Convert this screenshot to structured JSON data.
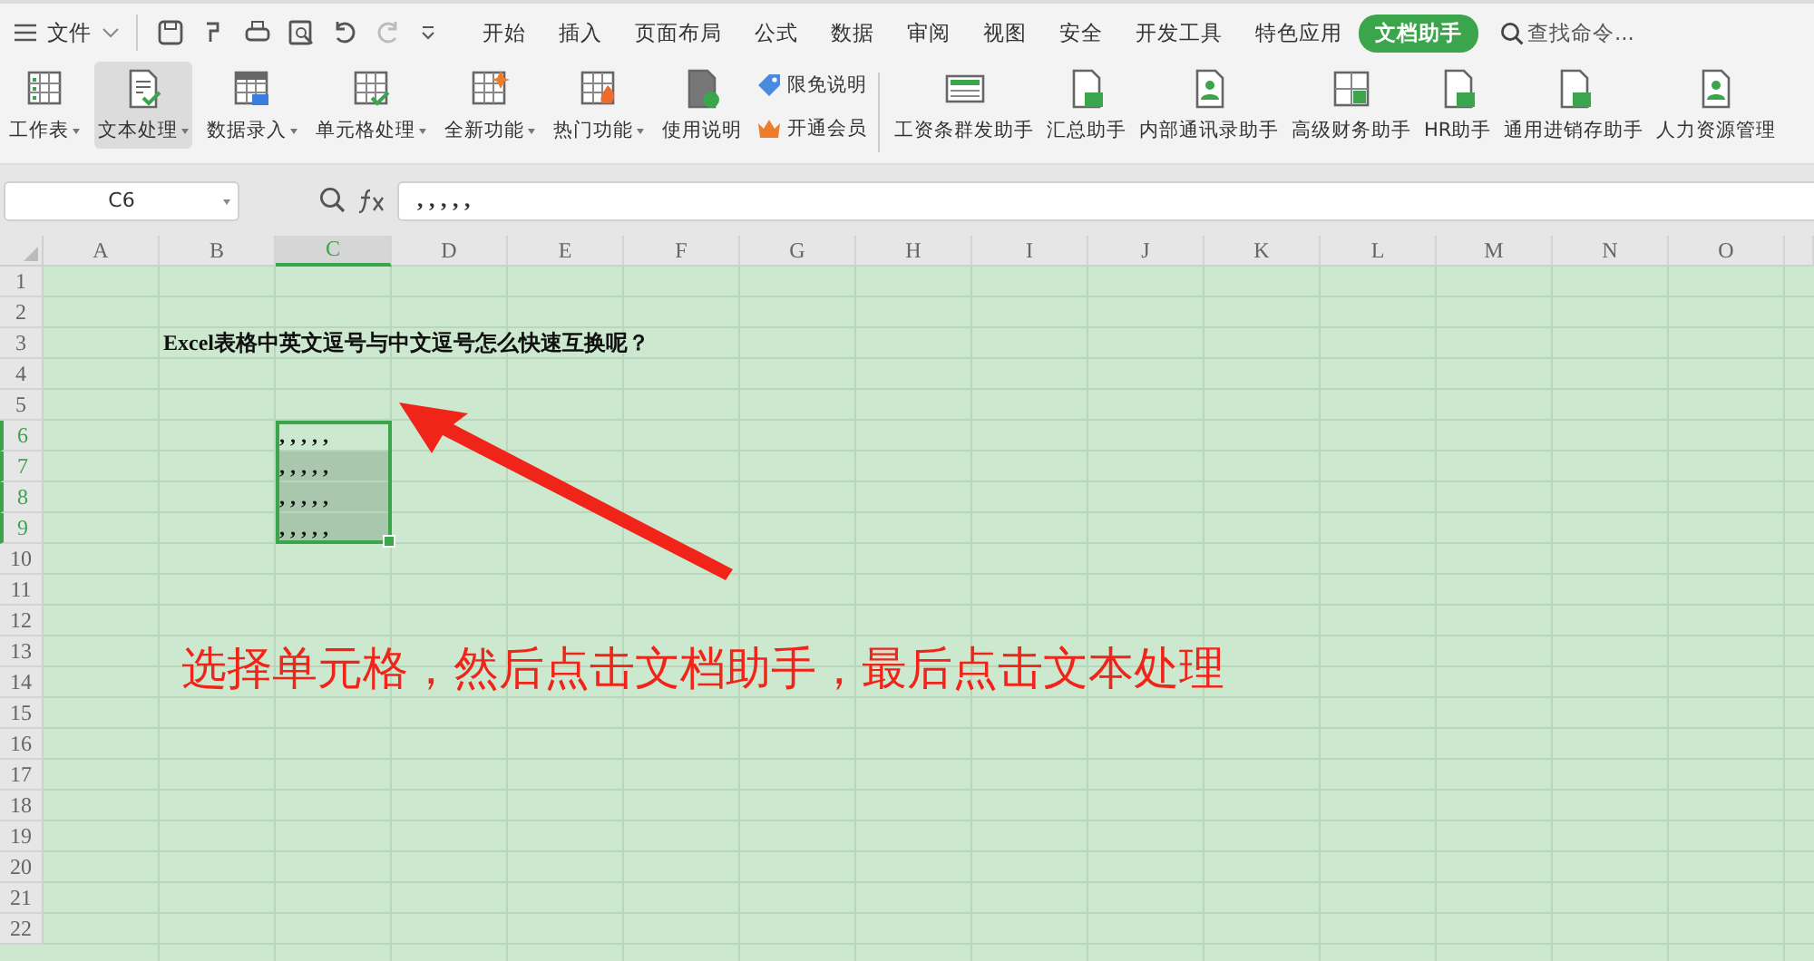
{
  "menubar": {
    "file_label": "文件",
    "tabs": [
      {
        "label": "开始",
        "selected": false
      },
      {
        "label": "插入",
        "selected": false
      },
      {
        "label": "页面布局",
        "selected": false
      },
      {
        "label": "公式",
        "selected": false
      },
      {
        "label": "数据",
        "selected": false
      },
      {
        "label": "审阅",
        "selected": false
      },
      {
        "label": "视图",
        "selected": false
      },
      {
        "label": "安全",
        "selected": false
      },
      {
        "label": "开发工具",
        "selected": false
      },
      {
        "label": "特色应用",
        "selected": false
      },
      {
        "label": "文档助手",
        "selected": true
      }
    ],
    "search_placeholder": "查找命令..."
  },
  "ribbon": {
    "tools": [
      {
        "label": "工作表",
        "dropdown": true,
        "selected": false
      },
      {
        "label": "文本处理",
        "dropdown": true,
        "selected": true
      },
      {
        "label": "数据录入",
        "dropdown": true,
        "selected": false
      },
      {
        "label": "单元格处理",
        "dropdown": true,
        "selected": false
      },
      {
        "label": "全新功能",
        "dropdown": true,
        "selected": false
      },
      {
        "label": "热门功能",
        "dropdown": true,
        "selected": false
      },
      {
        "label": "使用说明",
        "dropdown": false,
        "selected": false
      }
    ],
    "links": [
      "限免说明",
      "开通会员"
    ],
    "helpers": [
      "工资条群发助手",
      "汇总助手",
      "内部通讯录助手",
      "高级财务助手",
      "HR助手",
      "通用进销存助手",
      "人力资源管理"
    ]
  },
  "formula_bar": {
    "name_box": "C6",
    "formula": ", , , , ,"
  },
  "sheet": {
    "columns": [
      {
        "label": "A",
        "selected": false
      },
      {
        "label": "B",
        "selected": false
      },
      {
        "label": "C",
        "selected": true
      },
      {
        "label": "D",
        "selected": false
      },
      {
        "label": "E",
        "selected": false
      },
      {
        "label": "F",
        "selected": false
      },
      {
        "label": "G",
        "selected": false
      },
      {
        "label": "H",
        "selected": false
      },
      {
        "label": "I",
        "selected": false
      },
      {
        "label": "J",
        "selected": false
      },
      {
        "label": "K",
        "selected": false
      },
      {
        "label": "L",
        "selected": false
      },
      {
        "label": "M",
        "selected": false
      },
      {
        "label": "N",
        "selected": false
      },
      {
        "label": "O",
        "selected": false
      }
    ],
    "rows": [
      {
        "label": "1",
        "selected": false
      },
      {
        "label": "2",
        "selected": false
      },
      {
        "label": "3",
        "selected": false,
        "cells": [
          null,
          "Excel表格中英文逗号与中文逗号怎么快速互换呢？"
        ]
      },
      {
        "label": "4",
        "selected": false
      },
      {
        "label": "5",
        "selected": false
      },
      {
        "label": "6",
        "selected": true,
        "active": true,
        "cells": [
          null,
          null,
          ", , , , ,"
        ]
      },
      {
        "label": "7",
        "selected": true,
        "cells": [
          null,
          null,
          ", , , , ,"
        ]
      },
      {
        "label": "8",
        "selected": true,
        "cells": [
          null,
          null,
          ", , , , ,"
        ]
      },
      {
        "label": "9",
        "selected": true,
        "cells": [
          null,
          null,
          ", , , , ,"
        ]
      },
      {
        "label": "10",
        "selected": false
      },
      {
        "label": "11",
        "selected": false
      },
      {
        "label": "12",
        "selected": false
      },
      {
        "label": "13",
        "selected": false
      },
      {
        "label": "14",
        "selected": false
      },
      {
        "label": "15",
        "selected": false
      },
      {
        "label": "16",
        "selected": false
      },
      {
        "label": "17",
        "selected": false
      },
      {
        "label": "18",
        "selected": false
      },
      {
        "label": "19",
        "selected": false
      },
      {
        "label": "20",
        "selected": false
      },
      {
        "label": "21",
        "selected": false
      },
      {
        "label": "22",
        "selected": false
      }
    ]
  },
  "annotation": {
    "text": "选择单元格，然后点击文档助手，最后点击文本处理"
  }
}
